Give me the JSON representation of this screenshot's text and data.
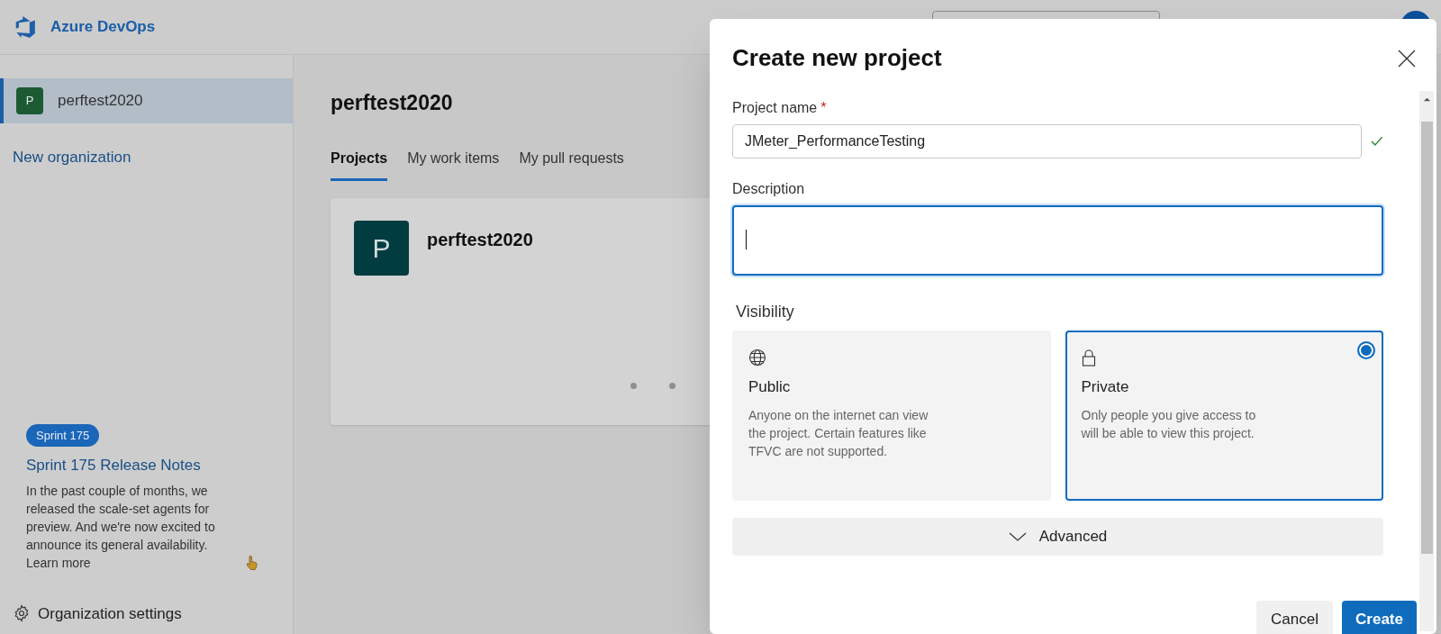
{
  "header": {
    "title": "Azure DevOps"
  },
  "sidebar": {
    "organizations": [
      {
        "initial": "P",
        "name": "perftest2020",
        "selected": true
      }
    ],
    "new_link": "New organization",
    "release": {
      "badge": "Sprint 175",
      "title": "Sprint 175 Release Notes",
      "text": "In the past couple of months, we released the scale-set agents for preview. And we're now excited to announce its general availability. Learn more"
    },
    "settings": "Organization settings"
  },
  "main": {
    "title": "perftest2020",
    "tabs": [
      {
        "label": "Projects",
        "selected": true
      },
      {
        "label": "My work items",
        "selected": false
      },
      {
        "label": "My pull requests",
        "selected": false
      }
    ],
    "projects": [
      {
        "initial": "P",
        "name": "perftest2020"
      }
    ]
  },
  "dialog": {
    "title": "Create new project",
    "project_name": {
      "label": "Project name",
      "required_mark": "*",
      "value": "JMeter_PerformanceTesting",
      "valid": true
    },
    "description": {
      "label": "Description",
      "focused": true
    },
    "visibility": {
      "label": "Visibility",
      "options": [
        {
          "kind": "public",
          "title": "Public",
          "text": "Anyone on the internet can view the project. Certain features like TFVC are not supported.",
          "selected": false
        },
        {
          "kind": "private",
          "title": "Private",
          "text": "Only people you give access to will be able to view this project.",
          "selected": true
        }
      ]
    },
    "advanced": {
      "label": "Advanced",
      "expanded": false
    },
    "buttons": [
      {
        "label": "Cancel",
        "kind": "secondary"
      },
      {
        "label": "Create",
        "kind": "primary"
      }
    ]
  }
}
